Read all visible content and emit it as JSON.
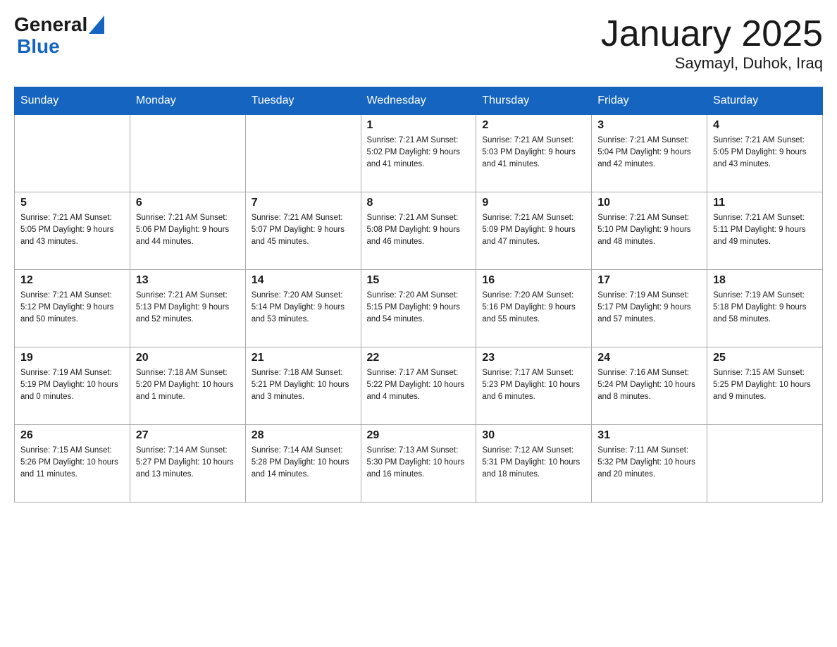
{
  "header": {
    "logo_general": "General",
    "logo_blue": "Blue",
    "title": "January 2025",
    "subtitle": "Saymayl, Duhok, Iraq"
  },
  "days_of_week": [
    "Sunday",
    "Monday",
    "Tuesday",
    "Wednesday",
    "Thursday",
    "Friday",
    "Saturday"
  ],
  "weeks": [
    [
      {
        "day": "",
        "info": ""
      },
      {
        "day": "",
        "info": ""
      },
      {
        "day": "",
        "info": ""
      },
      {
        "day": "1",
        "info": "Sunrise: 7:21 AM\nSunset: 5:02 PM\nDaylight: 9 hours\nand 41 minutes."
      },
      {
        "day": "2",
        "info": "Sunrise: 7:21 AM\nSunset: 5:03 PM\nDaylight: 9 hours\nand 41 minutes."
      },
      {
        "day": "3",
        "info": "Sunrise: 7:21 AM\nSunset: 5:04 PM\nDaylight: 9 hours\nand 42 minutes."
      },
      {
        "day": "4",
        "info": "Sunrise: 7:21 AM\nSunset: 5:05 PM\nDaylight: 9 hours\nand 43 minutes."
      }
    ],
    [
      {
        "day": "5",
        "info": "Sunrise: 7:21 AM\nSunset: 5:05 PM\nDaylight: 9 hours\nand 43 minutes."
      },
      {
        "day": "6",
        "info": "Sunrise: 7:21 AM\nSunset: 5:06 PM\nDaylight: 9 hours\nand 44 minutes."
      },
      {
        "day": "7",
        "info": "Sunrise: 7:21 AM\nSunset: 5:07 PM\nDaylight: 9 hours\nand 45 minutes."
      },
      {
        "day": "8",
        "info": "Sunrise: 7:21 AM\nSunset: 5:08 PM\nDaylight: 9 hours\nand 46 minutes."
      },
      {
        "day": "9",
        "info": "Sunrise: 7:21 AM\nSunset: 5:09 PM\nDaylight: 9 hours\nand 47 minutes."
      },
      {
        "day": "10",
        "info": "Sunrise: 7:21 AM\nSunset: 5:10 PM\nDaylight: 9 hours\nand 48 minutes."
      },
      {
        "day": "11",
        "info": "Sunrise: 7:21 AM\nSunset: 5:11 PM\nDaylight: 9 hours\nand 49 minutes."
      }
    ],
    [
      {
        "day": "12",
        "info": "Sunrise: 7:21 AM\nSunset: 5:12 PM\nDaylight: 9 hours\nand 50 minutes."
      },
      {
        "day": "13",
        "info": "Sunrise: 7:21 AM\nSunset: 5:13 PM\nDaylight: 9 hours\nand 52 minutes."
      },
      {
        "day": "14",
        "info": "Sunrise: 7:20 AM\nSunset: 5:14 PM\nDaylight: 9 hours\nand 53 minutes."
      },
      {
        "day": "15",
        "info": "Sunrise: 7:20 AM\nSunset: 5:15 PM\nDaylight: 9 hours\nand 54 minutes."
      },
      {
        "day": "16",
        "info": "Sunrise: 7:20 AM\nSunset: 5:16 PM\nDaylight: 9 hours\nand 55 minutes."
      },
      {
        "day": "17",
        "info": "Sunrise: 7:19 AM\nSunset: 5:17 PM\nDaylight: 9 hours\nand 57 minutes."
      },
      {
        "day": "18",
        "info": "Sunrise: 7:19 AM\nSunset: 5:18 PM\nDaylight: 9 hours\nand 58 minutes."
      }
    ],
    [
      {
        "day": "19",
        "info": "Sunrise: 7:19 AM\nSunset: 5:19 PM\nDaylight: 10 hours\nand 0 minutes."
      },
      {
        "day": "20",
        "info": "Sunrise: 7:18 AM\nSunset: 5:20 PM\nDaylight: 10 hours\nand 1 minute."
      },
      {
        "day": "21",
        "info": "Sunrise: 7:18 AM\nSunset: 5:21 PM\nDaylight: 10 hours\nand 3 minutes."
      },
      {
        "day": "22",
        "info": "Sunrise: 7:17 AM\nSunset: 5:22 PM\nDaylight: 10 hours\nand 4 minutes."
      },
      {
        "day": "23",
        "info": "Sunrise: 7:17 AM\nSunset: 5:23 PM\nDaylight: 10 hours\nand 6 minutes."
      },
      {
        "day": "24",
        "info": "Sunrise: 7:16 AM\nSunset: 5:24 PM\nDaylight: 10 hours\nand 8 minutes."
      },
      {
        "day": "25",
        "info": "Sunrise: 7:15 AM\nSunset: 5:25 PM\nDaylight: 10 hours\nand 9 minutes."
      }
    ],
    [
      {
        "day": "26",
        "info": "Sunrise: 7:15 AM\nSunset: 5:26 PM\nDaylight: 10 hours\nand 11 minutes."
      },
      {
        "day": "27",
        "info": "Sunrise: 7:14 AM\nSunset: 5:27 PM\nDaylight: 10 hours\nand 13 minutes."
      },
      {
        "day": "28",
        "info": "Sunrise: 7:14 AM\nSunset: 5:28 PM\nDaylight: 10 hours\nand 14 minutes."
      },
      {
        "day": "29",
        "info": "Sunrise: 7:13 AM\nSunset: 5:30 PM\nDaylight: 10 hours\nand 16 minutes."
      },
      {
        "day": "30",
        "info": "Sunrise: 7:12 AM\nSunset: 5:31 PM\nDaylight: 10 hours\nand 18 minutes."
      },
      {
        "day": "31",
        "info": "Sunrise: 7:11 AM\nSunset: 5:32 PM\nDaylight: 10 hours\nand 20 minutes."
      },
      {
        "day": "",
        "info": ""
      }
    ]
  ]
}
